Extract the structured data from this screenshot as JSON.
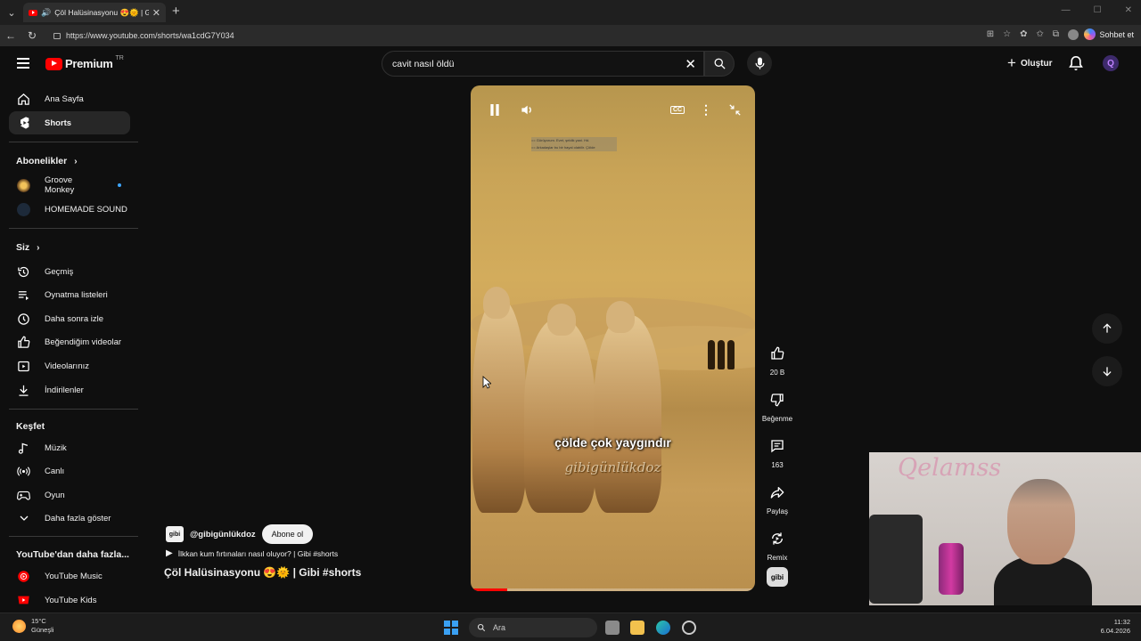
{
  "browser": {
    "tab_title": "Çöl Halüsinasyonu 😍🌞 | Gibi",
    "url": "https://www.youtube.com/shorts/wa1cdG7Y034",
    "copilot_label": "Sohbet et"
  },
  "header": {
    "logo_text": "Premium",
    "logo_region": "TR",
    "search_value": "cavit nasıl öldü",
    "create_label": "Oluştur",
    "account_initial": "Q"
  },
  "sidebar": {
    "main": [
      {
        "label": "Ana Sayfa",
        "icon": "home-icon"
      },
      {
        "label": "Shorts",
        "icon": "shorts-icon",
        "active": true
      }
    ],
    "subscriptions_heading": "Abonelikler",
    "subscriptions": [
      {
        "label": "Groove Monkey",
        "live": true
      },
      {
        "label": "HOMEMADE SOUND",
        "live": false
      }
    ],
    "you_heading": "Siz",
    "you": [
      {
        "label": "Geçmiş",
        "icon": "history-icon"
      },
      {
        "label": "Oynatma listeleri",
        "icon": "playlist-icon"
      },
      {
        "label": "Daha sonra izle",
        "icon": "clock-icon"
      },
      {
        "label": "Beğendiğim videolar",
        "icon": "like-icon"
      },
      {
        "label": "Videolarınız",
        "icon": "video-icon"
      },
      {
        "label": "İndirilenler",
        "icon": "download-icon"
      }
    ],
    "explore_heading": "Keşfet",
    "explore": [
      {
        "label": "Müzik",
        "icon": "music-icon"
      },
      {
        "label": "Canlı",
        "icon": "live-icon"
      },
      {
        "label": "Oyun",
        "icon": "gaming-icon"
      },
      {
        "label": "Daha fazla göster",
        "icon": "chevron-down-icon"
      }
    ],
    "more_heading": "YouTube'dan daha fazla...",
    "more": [
      {
        "label": "YouTube Music",
        "icon": "yt-music-icon"
      },
      {
        "label": "YouTube Kids",
        "icon": "yt-kids-icon"
      }
    ]
  },
  "player": {
    "caption_main": "çölde çok yaygındır",
    "caption_watermark": "gibigünlükdoz",
    "progress": 0.13,
    "subtitle_lines": [
      "== Görüyorum. Evet, şeldik yani. Hd.",
      "== Arkadaşlar bu bir hayal olabilir. Çölde"
    ]
  },
  "actions": {
    "like_count": "20 B",
    "dislike_label": "Beğenme",
    "comment_count": "163",
    "share_label": "Paylaş",
    "remix_label": "Remix",
    "channel_thumb": "gibi"
  },
  "video": {
    "channel_logo": "gibi",
    "channel_name": "@gibigünlükdoz",
    "subscribe_label": "Abone ol",
    "related_title": "İlkkan kum fırtınaları nasıl oluyor? | Gibi #shorts",
    "title": "Çöl Halüsinasyonu 😍🌞 | Gibi #shorts"
  },
  "webcam": {
    "sign_text": "Qelamss"
  },
  "taskbar": {
    "temperature": "15°C",
    "weather": "Güneşli",
    "search_placeholder": "Ara",
    "time": "11:32",
    "date": "6.04.2026"
  }
}
